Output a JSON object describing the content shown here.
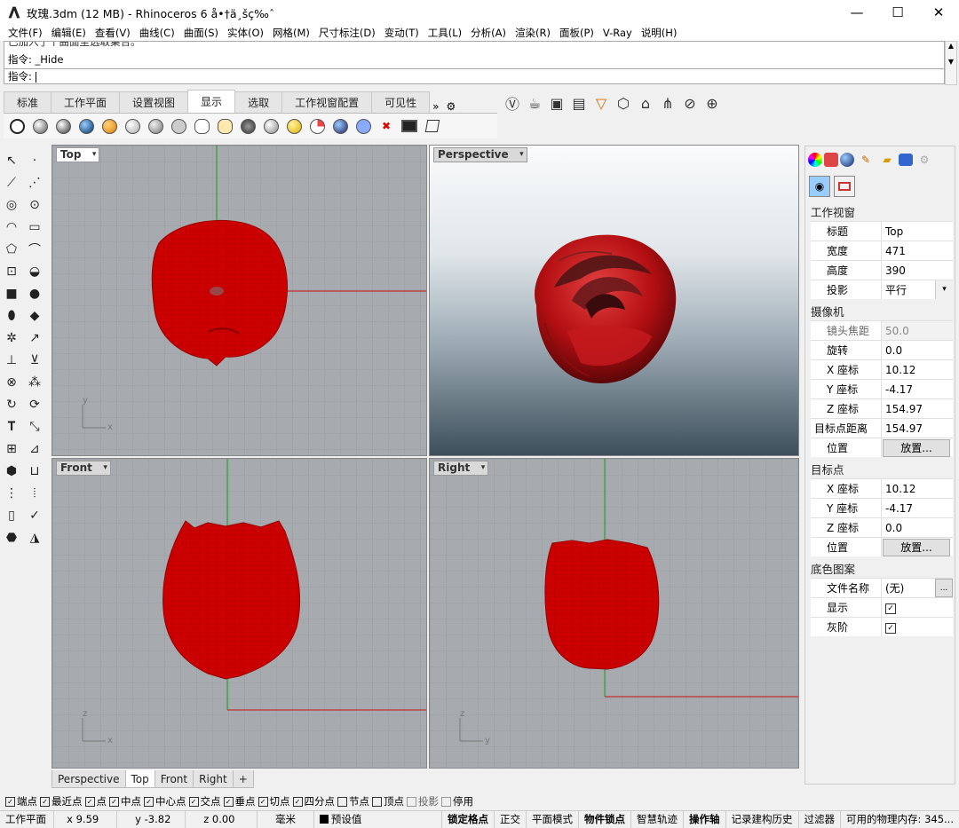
{
  "window": {
    "title": "玫瑰.3dm (12 MB) - Rhinoceros 6 å•†ä¸šç‰ˆ",
    "min": "—",
    "max": "☐",
    "close": "✕"
  },
  "menu": [
    "文件(F)",
    "编辑(E)",
    "查看(V)",
    "曲线(C)",
    "曲面(S)",
    "实体(O)",
    "网格(M)",
    "尺寸标注(D)",
    "变动(T)",
    "工具(L)",
    "分析(A)",
    "渲染(R)",
    "面板(P)",
    "V-Ray",
    "说明(H)"
  ],
  "command": {
    "history_partial": "已加入了个曲面至选取集合。",
    "history_last": "指令: _Hide",
    "prompt": "指令:"
  },
  "toolbar_tabs": {
    "items": [
      "标准",
      "工作平面",
      "设置视图",
      "显示",
      "选取",
      "工作视窗配置",
      "可见性"
    ],
    "active": "显示",
    "more": "»"
  },
  "viewports": {
    "top": {
      "label": "Top",
      "axis_a": "y",
      "axis_b": "x"
    },
    "perspective": {
      "label": "Perspective"
    },
    "front": {
      "label": "Front",
      "axis_a": "z",
      "axis_b": "x"
    },
    "right": {
      "label": "Right",
      "axis_a": "z",
      "axis_b": "y"
    }
  },
  "viewport_tabs": [
    "Perspective",
    "Top",
    "Front",
    "Right",
    "+"
  ],
  "viewport_tab_active": "Top",
  "panel": {
    "section_viewport": "工作视窗",
    "title_k": "标题",
    "title_v": "Top",
    "width_k": "宽度",
    "width_v": "471",
    "height_k": "高度",
    "height_v": "390",
    "proj_k": "投影",
    "proj_v": "平行",
    "section_camera": "摄像机",
    "lens_k": "镜头焦距",
    "lens_v": "50.0",
    "rot_k": "旋转",
    "rot_v": "0.0",
    "cx_k": "X 座标",
    "cx_v": "10.12",
    "cy_k": "Y 座标",
    "cy_v": "-4.17",
    "cz_k": "Z 座标",
    "cz_v": "154.97",
    "tdist_k": "目标点距离",
    "tdist_v": "154.97",
    "pos_k": "位置",
    "place_btn": "放置...",
    "section_target": "目标点",
    "tx_k": "X 座标",
    "tx_v": "10.12",
    "ty_k": "Y 座标",
    "ty_v": "-4.17",
    "tz_k": "Z 座标",
    "tz_v": "0.0",
    "tpos_k": "位置",
    "tplace_btn": "放置...",
    "section_bg": "底色图案",
    "fname_k": "文件名称",
    "fname_v": "(无)",
    "fname_btn": "...",
    "show_k": "显示",
    "gray_k": "灰阶"
  },
  "osnap": [
    {
      "label": "端点",
      "on": true
    },
    {
      "label": "最近点",
      "on": true
    },
    {
      "label": "点",
      "on": true
    },
    {
      "label": "中点",
      "on": true
    },
    {
      "label": "中心点",
      "on": true
    },
    {
      "label": "交点",
      "on": true
    },
    {
      "label": "垂点",
      "on": true
    },
    {
      "label": "切点",
      "on": true
    },
    {
      "label": "四分点",
      "on": true
    },
    {
      "label": "节点",
      "on": false
    },
    {
      "label": "顶点",
      "on": false
    },
    {
      "label": "投影",
      "on": false
    },
    {
      "label": "停用",
      "on": false
    }
  ],
  "status": {
    "cplane": "工作平面",
    "x": "x 9.59",
    "y": "y -3.82",
    "z": "z 0.00",
    "unit": "毫米",
    "layer": "预设值",
    "grid_snap": "锁定格点",
    "ortho": "正交",
    "planar": "平面模式",
    "osnap": "物件锁点",
    "smarttrack": "智慧轨迹",
    "gumball": "操作轴",
    "history": "记录建构历史",
    "filter": "过滤器",
    "memory": "可用的物理内存: 345..."
  },
  "colors": {
    "rose": "#cc0000",
    "grid_bg": "#a7abaf",
    "axis_x": "#c03030",
    "axis_y": "#2ea02e"
  }
}
